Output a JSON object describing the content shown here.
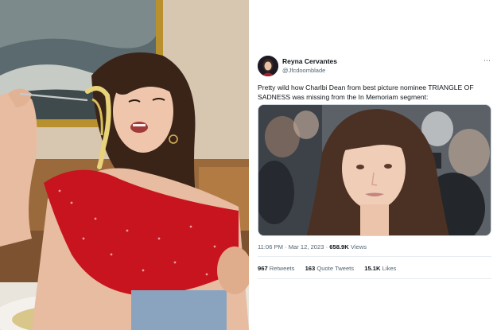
{
  "tweet": {
    "author_name": "Reyna Cervantes",
    "author_handle": "@Jfcdoomblade",
    "more_icon": "more-horizontal-icon",
    "text": "Pretty wild how Charlbi Dean from best picture nominee TRIANGLE OF SADNESS was missing from the In Memoriam segment:",
    "time": "11:06 PM",
    "separator": "·",
    "date": "Mar 12, 2023",
    "views_count": "658.9K",
    "views_label": "Views",
    "retweets_count": "967",
    "retweets_label": "Retweets",
    "quotes_count": "163",
    "quotes_label": "Quote Tweets",
    "likes_count": "15.1K",
    "likes_label": "Likes"
  },
  "colors": {
    "text_primary": "#0f1419",
    "text_secondary": "#536471",
    "border": "#cfd9de",
    "dress_red": "#c8141e"
  }
}
